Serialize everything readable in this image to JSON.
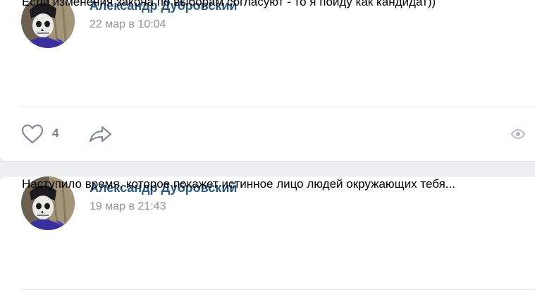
{
  "posts": [
    {
      "author": "Александр Дубровский",
      "date": "22 мар в 10:04",
      "text": "Если изменения закона по выборам согласуют - то я пойду как кандидат))",
      "likes": "4"
    },
    {
      "author": "Александр Дубровский",
      "date": "19 мар в 21:43",
      "text": "Наступило время, которое покажет истинное лицо людей окружающих тебя..."
    }
  ],
  "icons": {
    "like": "heart-outline-icon",
    "share": "share-arrow-icon",
    "views": "eye-icon"
  },
  "colors": {
    "author_link": "#2a5885",
    "date": "#939393",
    "icon": "#828a99",
    "background": "#edeef0"
  }
}
